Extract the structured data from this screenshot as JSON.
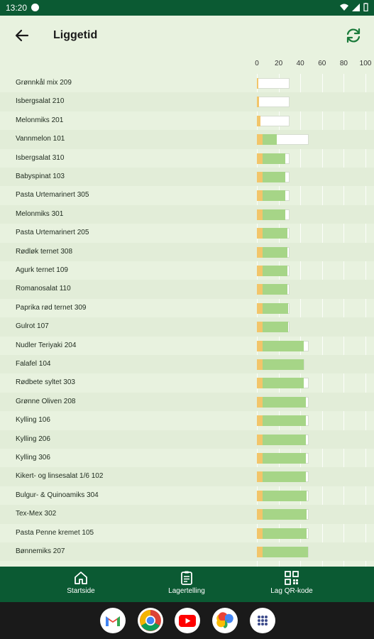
{
  "status_bar": {
    "time": "13:20"
  },
  "header": {
    "title": "Liggetid"
  },
  "chart_data": {
    "type": "bar",
    "orientation": "horizontal",
    "stacked": true,
    "xlim": [
      0,
      100
    ],
    "x_ticks": [
      "0",
      "20",
      "40",
      "60",
      "80",
      "100"
    ],
    "grid": true,
    "categories": [
      "Grønnkål mix 209",
      "Isbergsalat 210",
      "Melonmiks 201",
      "Vannmelon  101",
      "Isbergsalat 310",
      "Babyspinat 103",
      "Pasta Urtemarinert 305",
      "Melonmiks 301",
      "Pasta Urtemarinert 205",
      "Rødløk ternet 308",
      "Agurk ternet 109",
      "Romanosalat 110",
      "Paprika rød ternet 309",
      "Gulrot 107",
      "Nudler Teriyaki  204",
      "Falafel 104",
      "Rødbete syltet  303",
      "Grønne Oliven 208",
      "Kylling 106",
      "Kylling 206",
      "Kylling 306",
      "Kikert- og linsesalat 1/6 102",
      "Bulgur- & Quinoamiks 304",
      "Tex-Mex  302",
      "Pasta Penne kremet 105",
      "Bønnemiks  207"
    ],
    "series": [
      {
        "values": [
          1,
          2,
          3,
          5,
          5,
          5,
          5,
          5,
          5,
          5,
          5,
          5,
          5,
          5,
          5,
          5,
          5,
          5,
          5,
          5,
          5,
          5,
          5,
          5,
          5,
          5
        ]
      },
      {
        "values": [
          0,
          0,
          0,
          13,
          21,
          21,
          21,
          21,
          23,
          23,
          23,
          23,
          24,
          24,
          38,
          38,
          38,
          40,
          40,
          40,
          40,
          40,
          41,
          41,
          41,
          42
        ]
      },
      {
        "values": [
          30,
          30,
          30,
          48,
          30,
          30,
          30,
          30,
          30,
          30,
          30,
          30,
          30,
          30,
          48,
          44,
          48,
          48,
          48,
          48,
          48,
          48,
          48,
          48,
          48,
          48
        ]
      }
    ],
    "colors": {
      "start": "#f2c56a",
      "used": "#a6d587",
      "total": "#ffffff"
    }
  },
  "bottom_nav": {
    "items": [
      {
        "label": "Startside",
        "icon": "home-icon"
      },
      {
        "label": "Lagertelling",
        "icon": "clipboard-icon"
      },
      {
        "label": "Lag QR-kode",
        "icon": "qr-code-icon"
      }
    ]
  },
  "dock": {
    "apps": [
      "gmail-icon",
      "chrome-icon",
      "youtube-icon",
      "photos-icon",
      "app-drawer-icon"
    ]
  },
  "colors": {
    "primary": "#0b5a33",
    "background": "#e8f2df"
  }
}
